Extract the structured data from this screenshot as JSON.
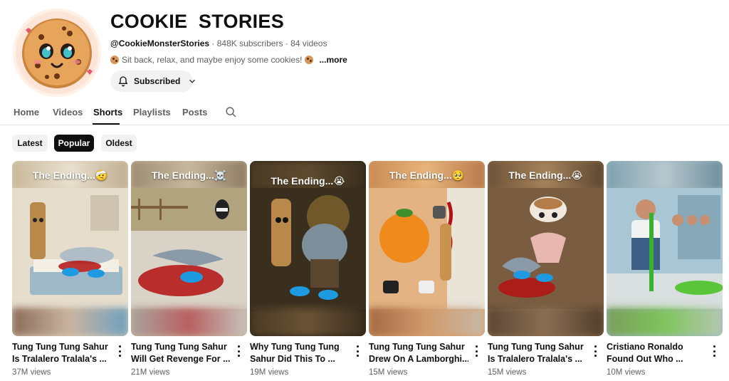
{
  "channel": {
    "name": "COOKIE  STORIES",
    "handle": "@CookieMonsterStories",
    "stats": " · 848K subscribers · 84 videos",
    "description": "Sit back, relax, and maybe enjoy some cookies!",
    "more": "...more",
    "avatar_icon": "cookie-face-icon",
    "subscribe_label": "Subscribed"
  },
  "tabs": [
    {
      "label": "Home"
    },
    {
      "label": "Videos"
    },
    {
      "label": "Shorts",
      "active": true
    },
    {
      "label": "Playlists"
    },
    {
      "label": "Posts"
    }
  ],
  "chips": [
    {
      "label": "Latest"
    },
    {
      "label": "Popular",
      "active": true
    },
    {
      "label": "Oldest"
    }
  ],
  "videos": [
    {
      "overlay": "The Ending...🤕",
      "line1": "Tung Tung Tung Sahur",
      "line2": "Is Tralalero Tralala's ...",
      "views": "37M views",
      "theme": "hospital"
    },
    {
      "overlay": "The Ending...☠️",
      "line1": "Tung Tung Tung Sahur",
      "line2": "Will Get Revenge For ...",
      "views": "21M views",
      "theme": "road"
    },
    {
      "overlay": "The Ending...😭",
      "line1": "Why Tung Tung Tung",
      "line2": "Sahur Did This To ...",
      "views": "19M views",
      "theme": "dark"
    },
    {
      "overlay": "The Ending...🥺",
      "line1": "Tung Tung Tung Sahur",
      "line2": "Drew On A Lamborghi...",
      "views": "15M views",
      "theme": "warm"
    },
    {
      "overlay": "The Ending...😭",
      "line1": "Tung Tung Tung Sahur",
      "line2": "Is Tralalero Tralala's ...",
      "views": "15M views",
      "theme": "dance"
    },
    {
      "overlay": "",
      "line1": "Cristiano Ronaldo",
      "line2": "Found Out Who ...",
      "views": "10M views",
      "theme": "locker"
    }
  ],
  "colors": {
    "accent": "#0f0f0f",
    "secondary_text": "#606060",
    "chip_bg": "#f2f2f2",
    "blood": "#b31212",
    "shoe_blue": "#1e9be0"
  }
}
